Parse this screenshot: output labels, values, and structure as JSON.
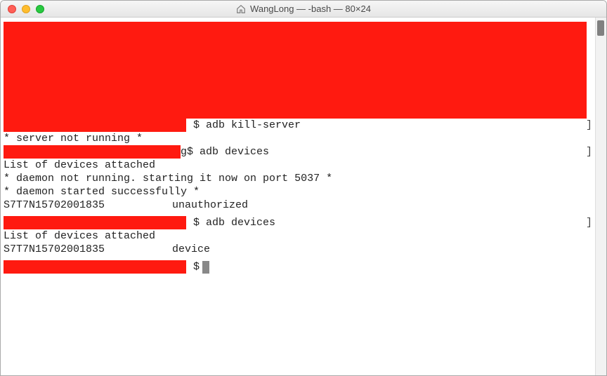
{
  "window": {
    "title": "WangLong — -bash — 80×24"
  },
  "terminal": {
    "lines": {
      "prompt1_cmd": "$ adb kill-server",
      "out1": "* server not running *",
      "prompt2_prefix": "g",
      "prompt2_cmd": "$ adb devices",
      "out2a": "List of devices attached",
      "out2b": "* daemon not running. starting it now on port 5037 *",
      "out2c": "* daemon started successfully *",
      "out2d_device": "S7T7N15702001835",
      "out2d_status": "unauthorized",
      "prompt3_cmd": "$ adb devices",
      "out3a": "List of devices attached",
      "out3b_device": "S7T7N15702001835",
      "out3b_status": "device",
      "prompt4": "$"
    }
  }
}
